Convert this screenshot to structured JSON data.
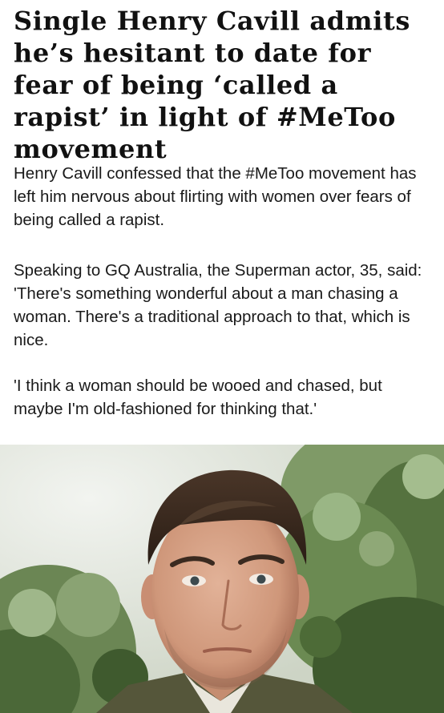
{
  "article": {
    "headline": "Single Henry Cavill admits he’s hesitant to date for fear of being ‘called a rapist’ in light of #MeToo movement",
    "paragraphs": [
      "Henry Cavill confessed that the #MeToo movement has left him nervous about flirting with women over fears of being called a rapist.",
      "Speaking to GQ Australia, the Superman actor, 35, said: 'There's something wonderful about a man chasing a woman. There's a traditional approach to that, which is nice.",
      "'I think a woman should be wooed and chased, but maybe I'm old-fashioned for thinking that.'"
    ]
  },
  "photo": {
    "subject": "portrait-photo",
    "colors": {
      "sky": "#e8ebe6",
      "foliage_dark": "#3f5a2e",
      "foliage_light": "#8fa877",
      "skin": "#d9a68a",
      "hair": "#3a2a20",
      "jacket": "#5a5a3c"
    }
  }
}
